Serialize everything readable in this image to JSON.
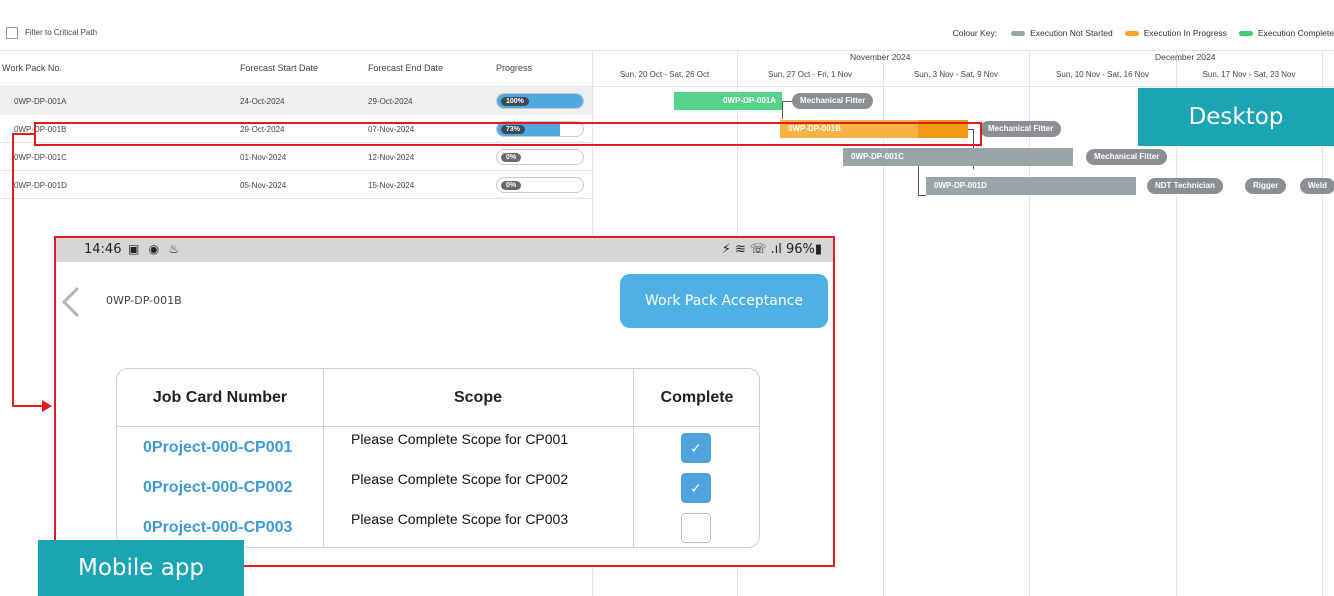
{
  "toolbar": {
    "critical_label": "Filter to Critical Path",
    "colour_key_label": "Colour Key:",
    "legend": [
      {
        "label": "Execution Not Started",
        "color": "#98a4a8"
      },
      {
        "label": "Execution In Progress",
        "color": "#f5a623"
      },
      {
        "label": "Execution Complete",
        "color": "#3dcf73"
      }
    ]
  },
  "grid": {
    "headers": {
      "work_pack": "Work Pack No.",
      "start": "Forecast Start Date",
      "end": "Forecast End Date",
      "progress": "Progress"
    },
    "months": [
      "November 2024",
      "December 2024"
    ],
    "weeks": [
      "Sun, 20 Oct - Sat, 26 Oct",
      "Sun, 27 Oct - Fri, 1 Nov",
      "Sun, 3 Nov - Sat, 9 Nov",
      "Sun, 10 Nov - Sat, 16 Nov",
      "Sun, 17 Nov - Sat, 23 Nov"
    ],
    "rows": [
      {
        "id": "0WP-DP-001A",
        "start": "24-Oct-2024",
        "end": "29-Oct-2024",
        "progress": "100%",
        "progress_value": 1.0
      },
      {
        "id": "0WP-DP-001B",
        "start": "29-Oct-2024",
        "end": "07-Nov-2024",
        "progress": "73%",
        "progress_value": 0.73
      },
      {
        "id": "0WP-DP-001C",
        "start": "01-Nov-2024",
        "end": "12-Nov-2024",
        "progress": "0%",
        "progress_value": 0
      },
      {
        "id": "0WP-DP-001D",
        "start": "05-Nov-2024",
        "end": "15-Nov-2024",
        "progress": "0%",
        "progress_value": 0
      }
    ],
    "bars": {
      "a": {
        "label": "0WP-DP-001A",
        "resource": "Mechanical Fitter"
      },
      "b": {
        "label": "0WP-DP-001B",
        "resource": "Mechanical Fitter"
      },
      "c": {
        "label": "0WP-DP-001C",
        "resource": "Mechanical Fitter"
      },
      "d": {
        "label": "0WP-DP-001D",
        "resources": [
          "NDT Technician",
          "Rigger",
          "Weld"
        ]
      }
    }
  },
  "tags": {
    "desktop": "Desktop",
    "mobile": "Mobile app"
  },
  "mobile": {
    "status": {
      "time": "14:46",
      "icons": "▣ ◉ ♨",
      "right": "⚡ ≋ ☏ .ıl 96%▮"
    },
    "title": "0WP-DP-001B",
    "accept_button": "Work Pack Acceptance",
    "table": {
      "headers": [
        "Job Card Number",
        "Scope",
        "Complete"
      ],
      "rows": [
        {
          "number": "0Project-000-CP001",
          "scope": "Please Complete Scope for CP001",
          "complete": true
        },
        {
          "number": "0Project-000-CP002",
          "scope": "Please Complete Scope for CP002",
          "complete": true
        },
        {
          "number": "0Project-000-CP003",
          "scope": "Please Complete Scope for CP003",
          "complete": false
        }
      ]
    }
  }
}
